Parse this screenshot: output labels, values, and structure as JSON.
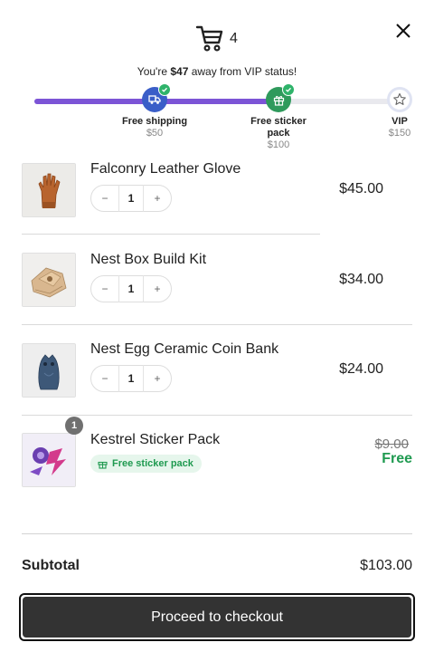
{
  "header": {
    "cart_count": "4",
    "cart_icon": "shopping-cart-icon",
    "close_icon": "close-icon"
  },
  "vip": {
    "prefix": "You're ",
    "amount": "$47",
    "suffix": " away from VIP status!"
  },
  "progress": {
    "fill_fraction": 0.66,
    "accent_color": "#7c54d6",
    "milestones": [
      {
        "label": "Free shipping",
        "amount": "$50",
        "icon": "truck-icon",
        "reached": true
      },
      {
        "label": "Free sticker pack",
        "amount": "$100",
        "icon": "gift-icon",
        "reached": true
      },
      {
        "label": "VIP",
        "amount": "$150",
        "icon": "star-icon",
        "reached": false
      }
    ]
  },
  "items": [
    {
      "name": "Falconry Leather Glove",
      "qty": "1",
      "price": "$45.00",
      "image": "leather-glove"
    },
    {
      "name": "Nest Box Build Kit",
      "qty": "1",
      "price": "$34.00",
      "image": "wooden-kit"
    },
    {
      "name": "Nest Egg Ceramic Coin Bank",
      "qty": "1",
      "price": "$24.00",
      "image": "ceramic-owl"
    }
  ],
  "free_item": {
    "name": "Kestrel Sticker Pack",
    "badge_count": "1",
    "pill_label": "Free sticker pack",
    "old_price": "$9.00",
    "free_label": "Free",
    "image": "sticker-pack"
  },
  "controls": {
    "minus": "−",
    "plus": "+"
  },
  "summary": {
    "subtotal_label": "Subtotal",
    "subtotal_value": "$103.00"
  },
  "checkout": {
    "label": "Proceed to checkout"
  },
  "colors": {
    "success": "#1f9a50",
    "button_bg": "#333333"
  }
}
